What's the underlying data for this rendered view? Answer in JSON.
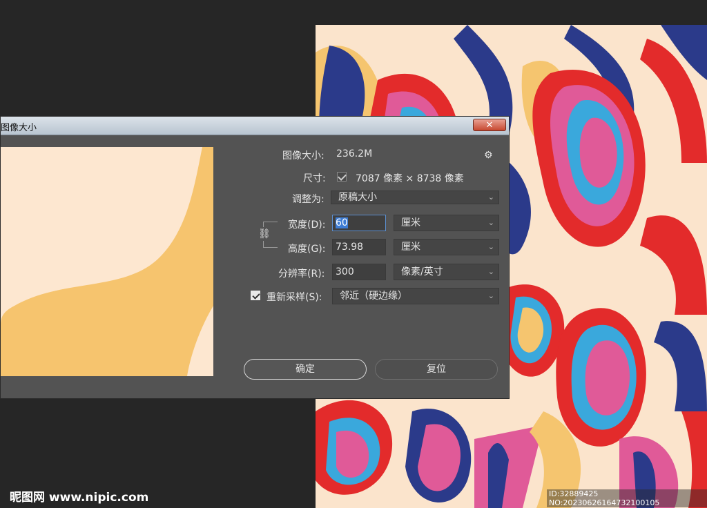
{
  "dialog": {
    "title": "图像大小",
    "close_label": "✕",
    "image_size_label": "图像大小:",
    "image_size_value": "236.2M",
    "gear_icon": "⚙",
    "dimensions_label": "尺寸:",
    "dimensions_value": "7087 像素 × 8738 像素",
    "fit_to_label": "调整为:",
    "fit_to_value": "原稿大小",
    "width_label": "宽度(D):",
    "width_value": "60",
    "width_unit": "厘米",
    "height_label": "高度(G):",
    "height_value": "73.98",
    "height_unit": "厘米",
    "resolution_label": "分辨率(R):",
    "resolution_value": "300",
    "resolution_unit": "像素/英寸",
    "resample_label": "重新采样(S):",
    "resample_value": "邻近（硬边缘）",
    "ok_label": "确定",
    "reset_label": "复位",
    "chain_icon": "⛓",
    "arrow": "⌄"
  },
  "watermark": {
    "site": "昵图网 www.nipic.com",
    "id_text": "ID:32889425 NO:20230626164732100105"
  },
  "colors": {
    "dialog_bg": "#535353",
    "preview_cream": "#fde7d0",
    "preview_yellow": "#f6c46e",
    "pattern_blue": "#2b3a8a",
    "pattern_red": "#e32b2b",
    "pattern_pink": "#e05a98",
    "pattern_cyan": "#3aa8dc",
    "pattern_orange": "#f07040"
  }
}
